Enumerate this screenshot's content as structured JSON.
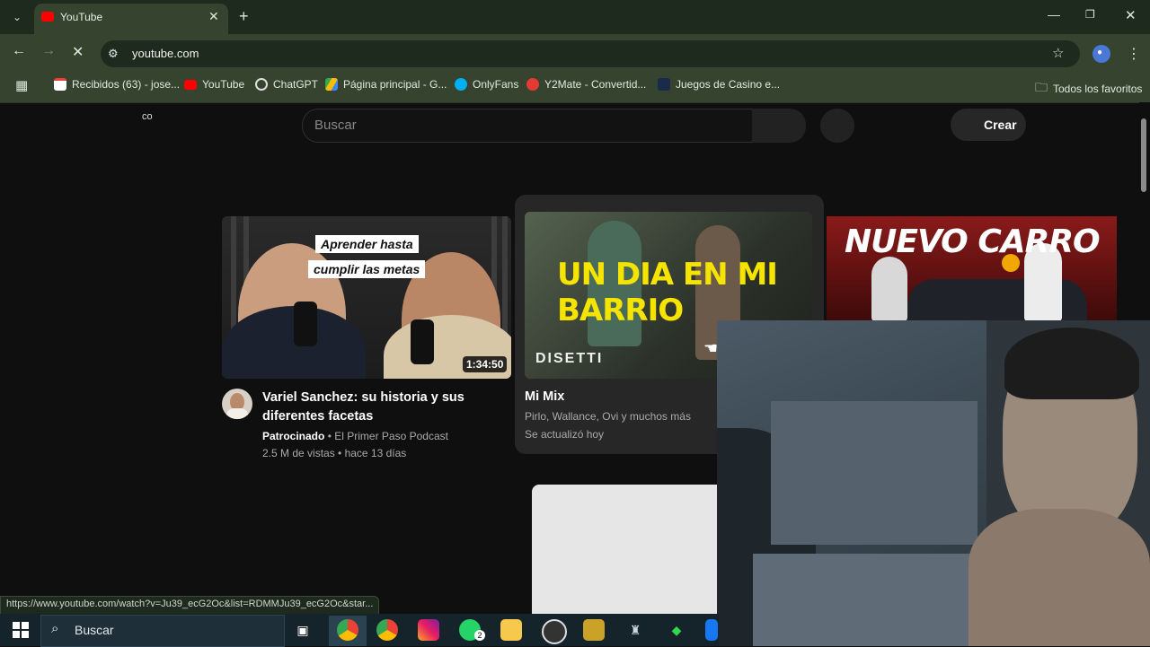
{
  "browser": {
    "tab_title": "YouTube",
    "url": "youtube.com",
    "bookmarks": [
      {
        "label": "Recibidos (63) - jose...",
        "icon": "gmail-icon"
      },
      {
        "label": "YouTube",
        "icon": "youtube-icon"
      },
      {
        "label": "ChatGPT",
        "icon": "chatgpt-icon"
      },
      {
        "label": "Página principal - G...",
        "icon": "drive-icon"
      },
      {
        "label": "OnlyFans",
        "icon": "onlyfans-icon"
      },
      {
        "label": "Y2Mate - Convertid...",
        "icon": "y2mate-icon"
      },
      {
        "label": "Juegos de Casino e...",
        "icon": "casino-icon"
      }
    ],
    "all_bookmarks": "Todos los favoritos",
    "status_url": "https://www.youtube.com/watch?v=Ju39_ecG2Oc&list=RDMMJu39_ecG2Oc&star..."
  },
  "youtube": {
    "corner_text": "co",
    "search_placeholder": "Buscar",
    "create_label": "Crear",
    "videos": [
      {
        "thumb_tag1": "Aprender hasta",
        "thumb_tag2": "cumplir las metas",
        "duration": "1:34:50",
        "title": "Variel Sanchez: su historia y sus diferentes facetas",
        "sponsored": "Patrocinado",
        "channel": "El Primer Paso Podcast",
        "stats": "2.5 M de vistas • hace 13 días"
      },
      {
        "thumb_title": "UN DIA EN MI BARRIO",
        "thumb_brand": "DISETTI",
        "title": "Mi Mix",
        "subtitle": "Pirlo, Wallance, Ovi y muchos más",
        "updated": "Se actualizó hoy"
      },
      {
        "thumb_title": "NUEVO CARRO"
      }
    ]
  },
  "taskbar": {
    "search_label": "Buscar",
    "whatsapp_badge": "2"
  },
  "colors": {
    "chrome_frame": "#35432f",
    "chrome_tabstrip": "#1f2a1f",
    "yt_background": "#0f0f0f",
    "mix_title_yellow": "#f5e400",
    "taskbar": "#15232b"
  }
}
